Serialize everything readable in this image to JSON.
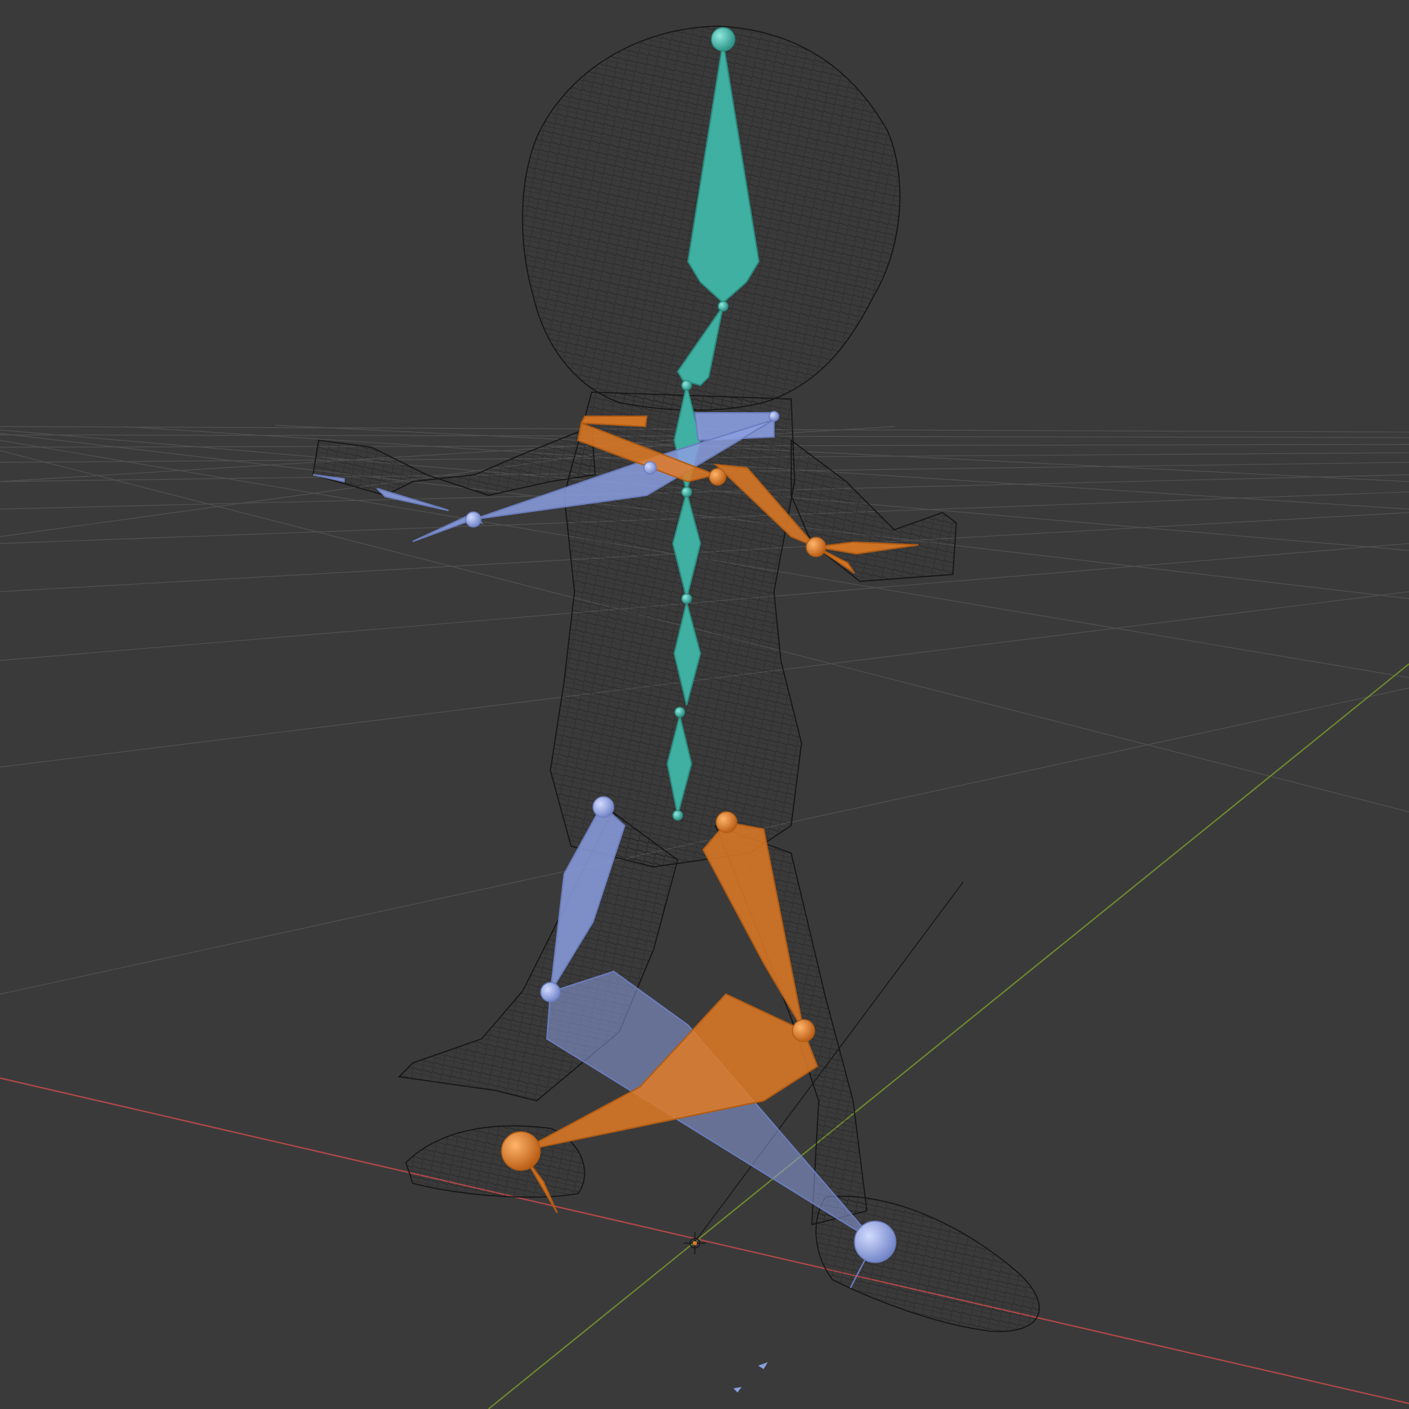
{
  "viewport": {
    "background_color": "#3a3a3a",
    "grid_color": "#505050",
    "x_axis_color": "#b34848",
    "y_axis_color": "#6f8a2e",
    "z_axis_color": "#1a1a1a",
    "wireframe_color": "#151515"
  },
  "armature": {
    "spine_color": "#3fb6a8",
    "left_side_color": "#8b9fe0",
    "right_side_color": "#e07a24"
  },
  "icons": {
    "origin": "world-origin-cursor-icon"
  }
}
